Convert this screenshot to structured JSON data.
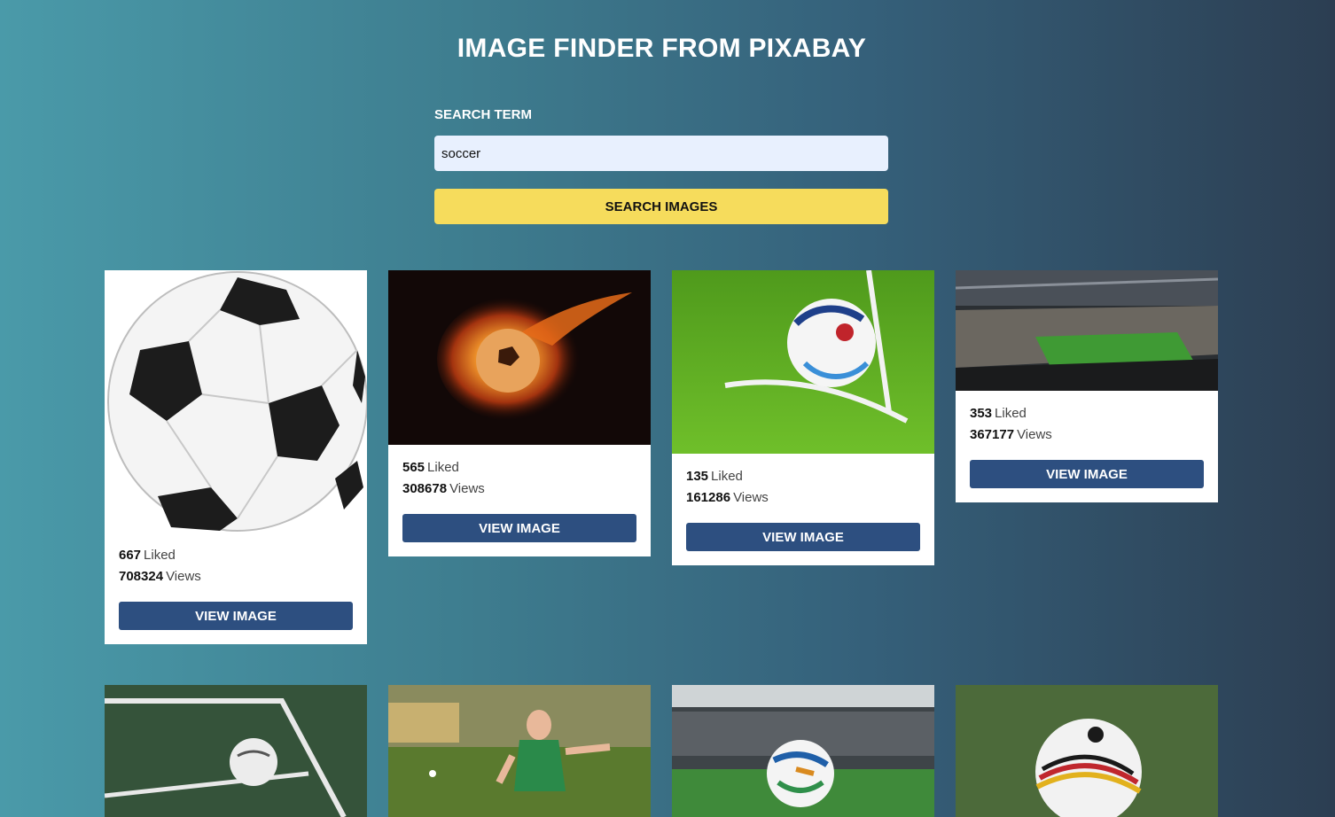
{
  "header": {
    "title": "IMAGE FINDER FROM PIXABAY"
  },
  "search": {
    "label": "SEARCH TERM",
    "value": "soccer",
    "button_label": "SEARCH IMAGES"
  },
  "colors": {
    "accent_button": "#f6dc5c",
    "view_button": "#2d4f80",
    "input_bg": "#e8f0fe"
  },
  "results": [
    {
      "image": "soccer-ball-illustration",
      "likes": "667",
      "likes_label": "Liked",
      "views": "708324",
      "views_label": "Views",
      "button_label": "VIEW IMAGE"
    },
    {
      "image": "fire-soccer-ball",
      "likes": "565",
      "likes_label": "Liked",
      "views": "308678",
      "views_label": "Views",
      "button_label": "VIEW IMAGE"
    },
    {
      "image": "ball-on-corner-grass",
      "likes": "135",
      "likes_label": "Liked",
      "views": "161286",
      "views_label": "Views",
      "button_label": "VIEW IMAGE"
    },
    {
      "image": "stadium-panorama",
      "likes": "353",
      "likes_label": "Liked",
      "views": "367177",
      "views_label": "Views",
      "button_label": "VIEW IMAGE"
    }
  ],
  "second_row": [
    {
      "image": "ball-at-corner-line"
    },
    {
      "image": "boy-kicking-ball"
    },
    {
      "image": "ball-in-stadium"
    },
    {
      "image": "white-ball-on-grass"
    }
  ]
}
